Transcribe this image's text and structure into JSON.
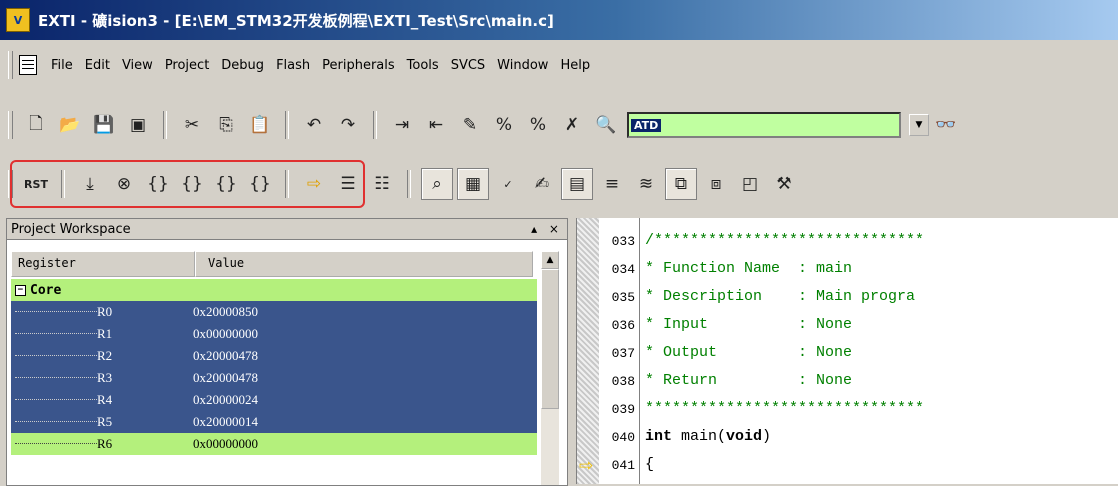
{
  "window": {
    "title": "EXTI  - 礦ision3 - [E:\\EM_STM32开发板例程\\EXTI_Test\\Src\\main.c]",
    "app_icon_text": "V"
  },
  "menu": [
    "File",
    "Edit",
    "View",
    "Project",
    "Debug",
    "Flash",
    "Peripherals",
    "Tools",
    "SVCS",
    "Window",
    "Help"
  ],
  "toolbar": {
    "combo_value": "ATD"
  },
  "workspace": {
    "title": "Project Workspace",
    "controls": "▴ ×",
    "columns": [
      "Register",
      "Value"
    ],
    "group": "Core",
    "registers": [
      {
        "name": "R0",
        "value": "0x20000850"
      },
      {
        "name": "R1",
        "value": "0x00000000"
      },
      {
        "name": "R2",
        "value": "0x20000478"
      },
      {
        "name": "R3",
        "value": "0x20000478"
      },
      {
        "name": "R4",
        "value": "0x20000024"
      },
      {
        "name": "R5",
        "value": "0x20000014"
      },
      {
        "name": "R6",
        "value": "0x00000000"
      }
    ]
  },
  "editor": {
    "lines": [
      {
        "no": "033",
        "text": "/******************************"
      },
      {
        "no": "034",
        "text": "* Function Name  : main"
      },
      {
        "no": "035",
        "text": "* Description    : Main progra"
      },
      {
        "no": "036",
        "text": "* Input          : None"
      },
      {
        "no": "037",
        "text": "* Output         : None"
      },
      {
        "no": "038",
        "text": "* Return         : None"
      },
      {
        "no": "039",
        "text": "*******************************"
      },
      {
        "no": "040",
        "text_kw": "int",
        "text_mid": " main(",
        "text_kw2": "void",
        "text_end": ")"
      },
      {
        "no": "041",
        "text": "{"
      }
    ]
  },
  "colors": {
    "selection": "#3a558c",
    "core_row": "#b4f07c",
    "highlight_box": "#e03030",
    "comment": "#008000"
  }
}
